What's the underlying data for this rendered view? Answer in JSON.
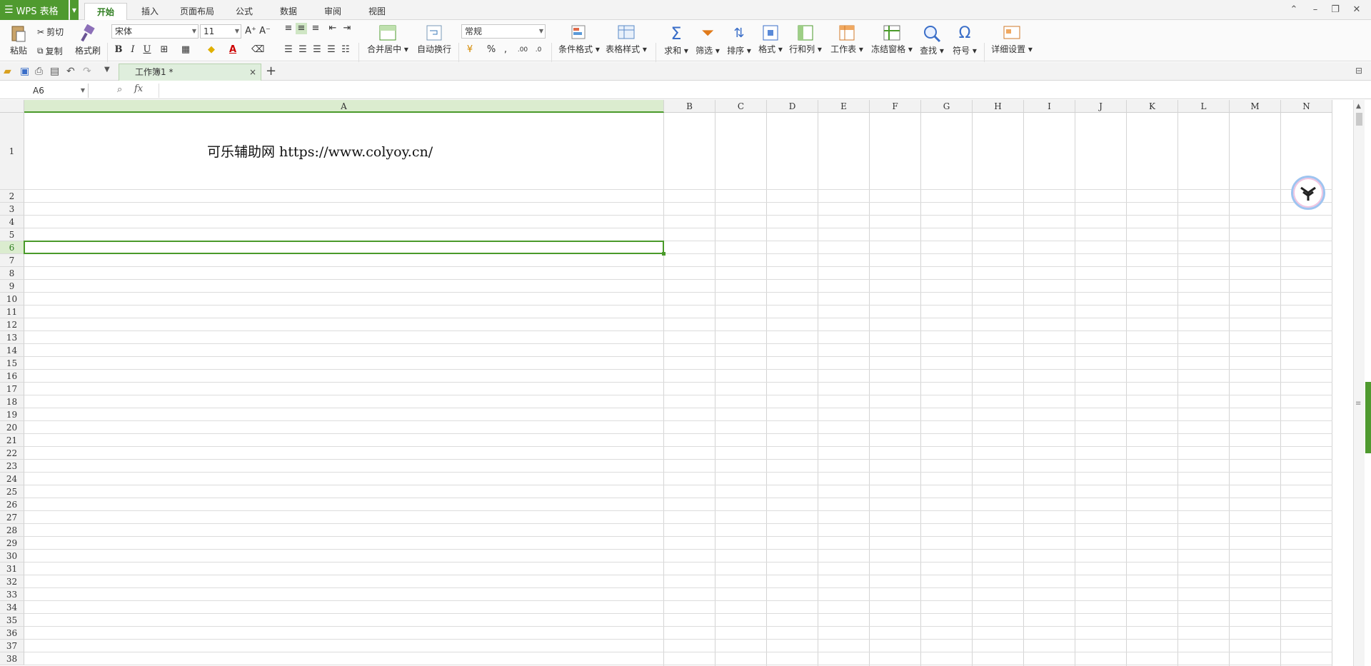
{
  "app": {
    "logo_text": "WPS 表格",
    "brand_color": "#4f9a2f"
  },
  "menu": {
    "tabs": [
      "开始",
      "插入",
      "页面布局",
      "公式",
      "数据",
      "审阅",
      "视图"
    ],
    "active_tab": "开始"
  },
  "ribbon": {
    "paste": "粘贴",
    "cut": "剪切",
    "copy": "复制",
    "format_painter": "格式刷",
    "font_name": "宋体",
    "font_size": "11",
    "bold": "B",
    "italic": "I",
    "underline": "U",
    "merge_center": "合并居中",
    "wrap_text": "自动换行",
    "number_format": "常规",
    "percent": "%",
    "comma": ",",
    "conditional_format": "条件格式",
    "table_style": "表格样式",
    "sum": "求和",
    "filter": "筛选",
    "sort": "排序",
    "format": "格式",
    "row_col": "行和列",
    "worksheet": "工作表",
    "freeze": "冻结窗格",
    "find": "查找",
    "symbol": "符号",
    "settings": "详细设置"
  },
  "quickbar": {
    "doc_tab": "工作簿1 *",
    "close": "×",
    "add": "+"
  },
  "formula_bar": {
    "name_box": "A6",
    "fx": "fx",
    "value": ""
  },
  "sheet": {
    "columns": [
      "A",
      "B",
      "C",
      "D",
      "E",
      "F",
      "G",
      "H",
      "I",
      "J",
      "K",
      "L",
      "M",
      "N"
    ],
    "selected_column": "A",
    "selected_row": "6",
    "rows": [
      "1",
      "2",
      "3",
      "4",
      "5",
      "6",
      "7",
      "8",
      "9",
      "10",
      "11",
      "12",
      "13",
      "14",
      "15",
      "16",
      "17",
      "18",
      "19",
      "20",
      "21",
      "22",
      "23",
      "24",
      "25",
      "26",
      "27",
      "28",
      "29",
      "30",
      "31",
      "32",
      "33",
      "34",
      "35",
      "36",
      "37",
      "38"
    ],
    "a1_value": "可乐辅助网 https://www.colyoy.cn/"
  }
}
